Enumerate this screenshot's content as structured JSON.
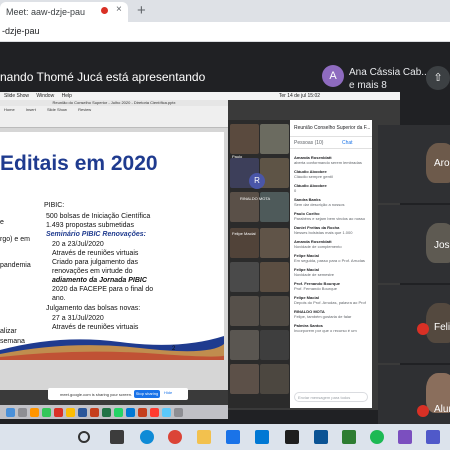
{
  "browser": {
    "tab_title": "Meet: aaw-dzje-pau",
    "tab_close": "×",
    "new_tab": "+",
    "address": "-dzje-pau"
  },
  "meet": {
    "presenter_text": "nando Thomé Jucá está apresentando",
    "participant_initial": "A",
    "participant_name": "Ana Cássia Cab...",
    "participant_more": "e mais 8",
    "right_tiles": [
      {
        "name": "Aro"
      },
      {
        "name": "Jos"
      },
      {
        "name": "Feli"
      },
      {
        "name": "Alur"
      }
    ]
  },
  "mac": {
    "menubar": [
      "Slide Show",
      "Window",
      "Help"
    ],
    "clock": "Ter 14 de jul 15:02"
  },
  "ppt": {
    "window_title": "Reunião do Conselho Superior - Julho 2020 - Diretoria Científica.pptx",
    "ribbon_tabs": [
      "Home",
      "Insert",
      "Slide Show",
      "Review"
    ]
  },
  "slide": {
    "title": "Editais em 2020",
    "left_stubs": [
      "e",
      "rgo) e em",
      "pandemia",
      "alizar",
      "semana"
    ],
    "pibic_heading": "PIBIC:",
    "bullets": [
      {
        "level": 1,
        "text": "500 bolsas de Iniciação Científica"
      },
      {
        "level": 1,
        "text": "1.493 propostas submetidas"
      },
      {
        "level": 1,
        "text": "Seminário PIBIC Renovações:",
        "style": "sem"
      },
      {
        "level": 2,
        "text": "20 a 23/Jul/2020"
      },
      {
        "level": 2,
        "text": "Através de reuniões virtuais"
      },
      {
        "level": 2,
        "text": "Criado para julgamento das"
      },
      {
        "level": 2,
        "text": "renovações em virtude do"
      },
      {
        "level": 2,
        "text": "adiamento da Jornada PIBIC"
      },
      {
        "level": 2,
        "text": "2020 da FACEPE para o final do"
      },
      {
        "level": 2,
        "text": "ano."
      },
      {
        "level": 1,
        "text": "Julgamento das bolsas novas:"
      },
      {
        "level": 2,
        "text": "27 a 31/Jul/2020"
      },
      {
        "level": 2,
        "text": "Através de reuniões virtuais"
      }
    ],
    "number": "2"
  },
  "sharebar": {
    "text": "meet.google.com is sharing your screen.",
    "stop": "Stop sharing",
    "hide": "Hide"
  },
  "inner_meet": {
    "r_initial": "R",
    "captions": [
      "Paulo",
      "RINALDO MOTA",
      "Felipe Macial"
    ]
  },
  "chat": {
    "header": "Reunião Conselho Superior da F...",
    "tab_people": "Pessoas (10)",
    "tab_chat": "Chat",
    "messages": [
      {
        "name": "Amanda Rosenblatt",
        "text": "aberta conformando serem lembradas"
      },
      {
        "name": "Cláudio Aboobee",
        "text": "Cláudio sempre gentil"
      },
      {
        "name": "Cláudio Aboobee",
        "text": "0"
      },
      {
        "name": "Sandra Banks",
        "text": "Sem dar descrição a nossos"
      },
      {
        "name": "Paulo Coelho",
        "text": "Parabéns e sejam bem vindos ao nosso"
      },
      {
        "name": "Daniel Freitas da Rocha",
        "text": "Nesses bolsistas mais que 1.000"
      },
      {
        "name": "Amanda Rosenblatt",
        "text": "Novidade de complemento"
      },
      {
        "name": "Felipe Macial",
        "text": "Em seguida, passo para o Prof. Arrudas"
      },
      {
        "name": "Felipe Macial",
        "text": "Novidade de semestre"
      },
      {
        "name": "Prof. Fernando Bourque",
        "text": "Prof. Fernando Bourque"
      },
      {
        "name": "Felipe Macial",
        "text": "Depois do Prof. Arrudas, palavra ao Prof"
      },
      {
        "name": "RINALDO MOTA",
        "text": "Felipe, também gostaria de falar"
      },
      {
        "name": "Palmira Santos",
        "text": "Incorporem por que o recurso é um"
      }
    ],
    "input_placeholder": "Enviar mensagem para todos"
  }
}
